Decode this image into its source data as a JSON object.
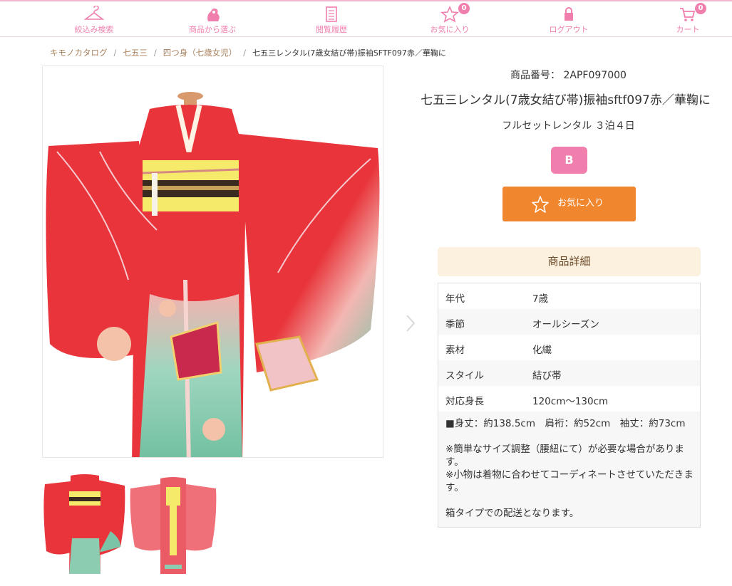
{
  "nav": {
    "items": [
      {
        "label": "絞込み検索",
        "icon": "hanger-icon"
      },
      {
        "label": "商品から選ぶ",
        "icon": "kimono-bag-icon"
      },
      {
        "label": "閲覧履歴",
        "icon": "history-list-icon"
      },
      {
        "label": "お気に入り",
        "icon": "star-icon",
        "badge": "0"
      },
      {
        "label": "ログアウト",
        "icon": "lock-icon"
      },
      {
        "label": "カート",
        "icon": "cart-icon",
        "badge": "0"
      }
    ]
  },
  "breadcrumb": {
    "items": [
      "キモノカタログ",
      "七五三",
      "四つ身（七歳女児）"
    ],
    "current": "七五三レンタル(7歳女結び帯)振袖SFTF097赤／華鞠に"
  },
  "product": {
    "code_label": "商品番号：",
    "code_value": "2APF097000",
    "title": "七五三レンタル(7歳女結び帯)振袖sftf097赤／華鞠に",
    "rental_plan": "フルセットレンタル ３泊４日",
    "rank": "B",
    "favorite_label": "お気に入り"
  },
  "details": {
    "heading": "商品詳細",
    "rows": [
      {
        "key": "年代",
        "value": "7歳"
      },
      {
        "key": "季節",
        "value": "オールシーズン"
      },
      {
        "key": "素材",
        "value": "化繊"
      },
      {
        "key": "スタイル",
        "value": "結び帯"
      },
      {
        "key": "対応身長",
        "value": "120cm〜130cm"
      }
    ],
    "sizes": "■身丈：約138.5cm　肩裄：約52cm　袖丈：約73cm",
    "note1": "※簡単なサイズ調整（腰紐にて）が必要な場合があります。",
    "note2": "※小物は着物に合わせてコーディネートさせていただきます。",
    "note3": "箱タイプでの配送となります。"
  },
  "colors": {
    "brand_pink": "#f07fae",
    "favorite_orange": "#f0862d",
    "kimono_red": "#e8343a",
    "kimono_green": "#7cc4a8",
    "detail_header_bg": "#fbf1de"
  }
}
